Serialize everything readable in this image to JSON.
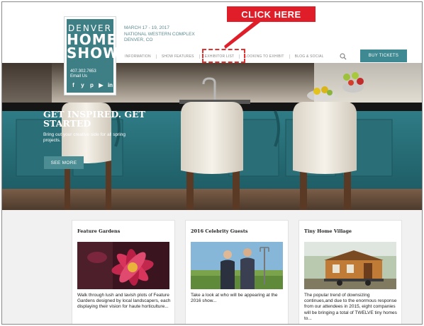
{
  "logo": {
    "line1": "DENVER",
    "line2": "HOME",
    "line3": "SHOW",
    "phone": "407.302.7653",
    "email": "Email Us",
    "social": [
      "f",
      "y",
      "p",
      "▶",
      "in"
    ]
  },
  "event": {
    "dates": "MARCH 17 - 19, 2017",
    "venue": "NATIONAL WESTERN COMPLEX",
    "city": "DENVER, CO"
  },
  "nav": {
    "items": [
      "INFORMATION",
      "SHOW FEATURES",
      "EXHIBITOR LIST",
      "LOOKING TO EXHIBIT",
      "BLOG & SOCIAL"
    ],
    "buy_tickets": "BUY TICKETS",
    "search_icon": "search-icon"
  },
  "annotation": {
    "callout": "CLICK HERE",
    "color": "#e01e29"
  },
  "hero": {
    "title": "GET INSPIRED. GET STARTED",
    "subtitle": "Bring out your creative side for all spring projects.",
    "button": "SEE MORE",
    "slide_count": 7,
    "active_slide": 1
  },
  "cards": [
    {
      "title": "Feature Gardens",
      "desc": "Walk through lush and lavish plots of Feature Gardens designed by local landscapers, each displaying their vision for haute horticulture..."
    },
    {
      "title": "2016 Celebrity Guests",
      "desc": "Take a look at who will be appearing at the 2016 show..."
    },
    {
      "title": "Tiny Home Village",
      "desc": "The popular trend of downsizing continues,and due to the enormous response from our attendees in 2015, eight companies will be bringing a total of TWELVE tiny homes to..."
    }
  ],
  "colors": {
    "brand_teal": "#3e7f86",
    "accent_red": "#e01e29"
  }
}
